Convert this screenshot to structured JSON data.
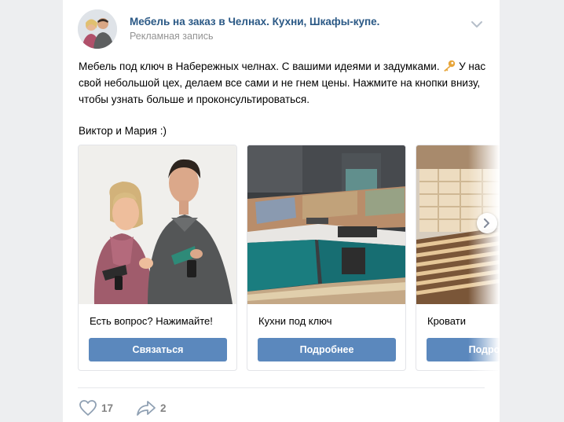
{
  "post": {
    "author": "Мебель на заказ в Челнах. Кухни, Шкафы-купе.",
    "subtitle": "Рекламная запись",
    "text_before_icon": "Мебель под ключ в Набережных челнах. С вашими идеями и задумками. ",
    "text_after_icon": " У нас свой небольшой цех, делаем все сами и не гнем цены. Нажмите на кнопки внизу, чтобы узнать больше и проконсультироваться.",
    "signature": "Виктор и Мария :)"
  },
  "carousel": {
    "cards": [
      {
        "title": "Есть вопрос? Нажимайте!",
        "button": "Связаться"
      },
      {
        "title": "Кухни под ключ",
        "button": "Подробнее"
      },
      {
        "title": "Кровати",
        "button": "Подробнее"
      }
    ]
  },
  "actions": {
    "likes": "17",
    "shares": "2"
  },
  "icons": {
    "menu": "chevron-down-icon",
    "inline": "key-icon",
    "like": "heart-icon",
    "share": "share-arrow-icon",
    "carousel_next": "chevron-right-icon"
  },
  "colors": {
    "link": "#2a5885",
    "button": "#5b88bd",
    "page_background": "#edeef0",
    "muted": "#939393"
  }
}
